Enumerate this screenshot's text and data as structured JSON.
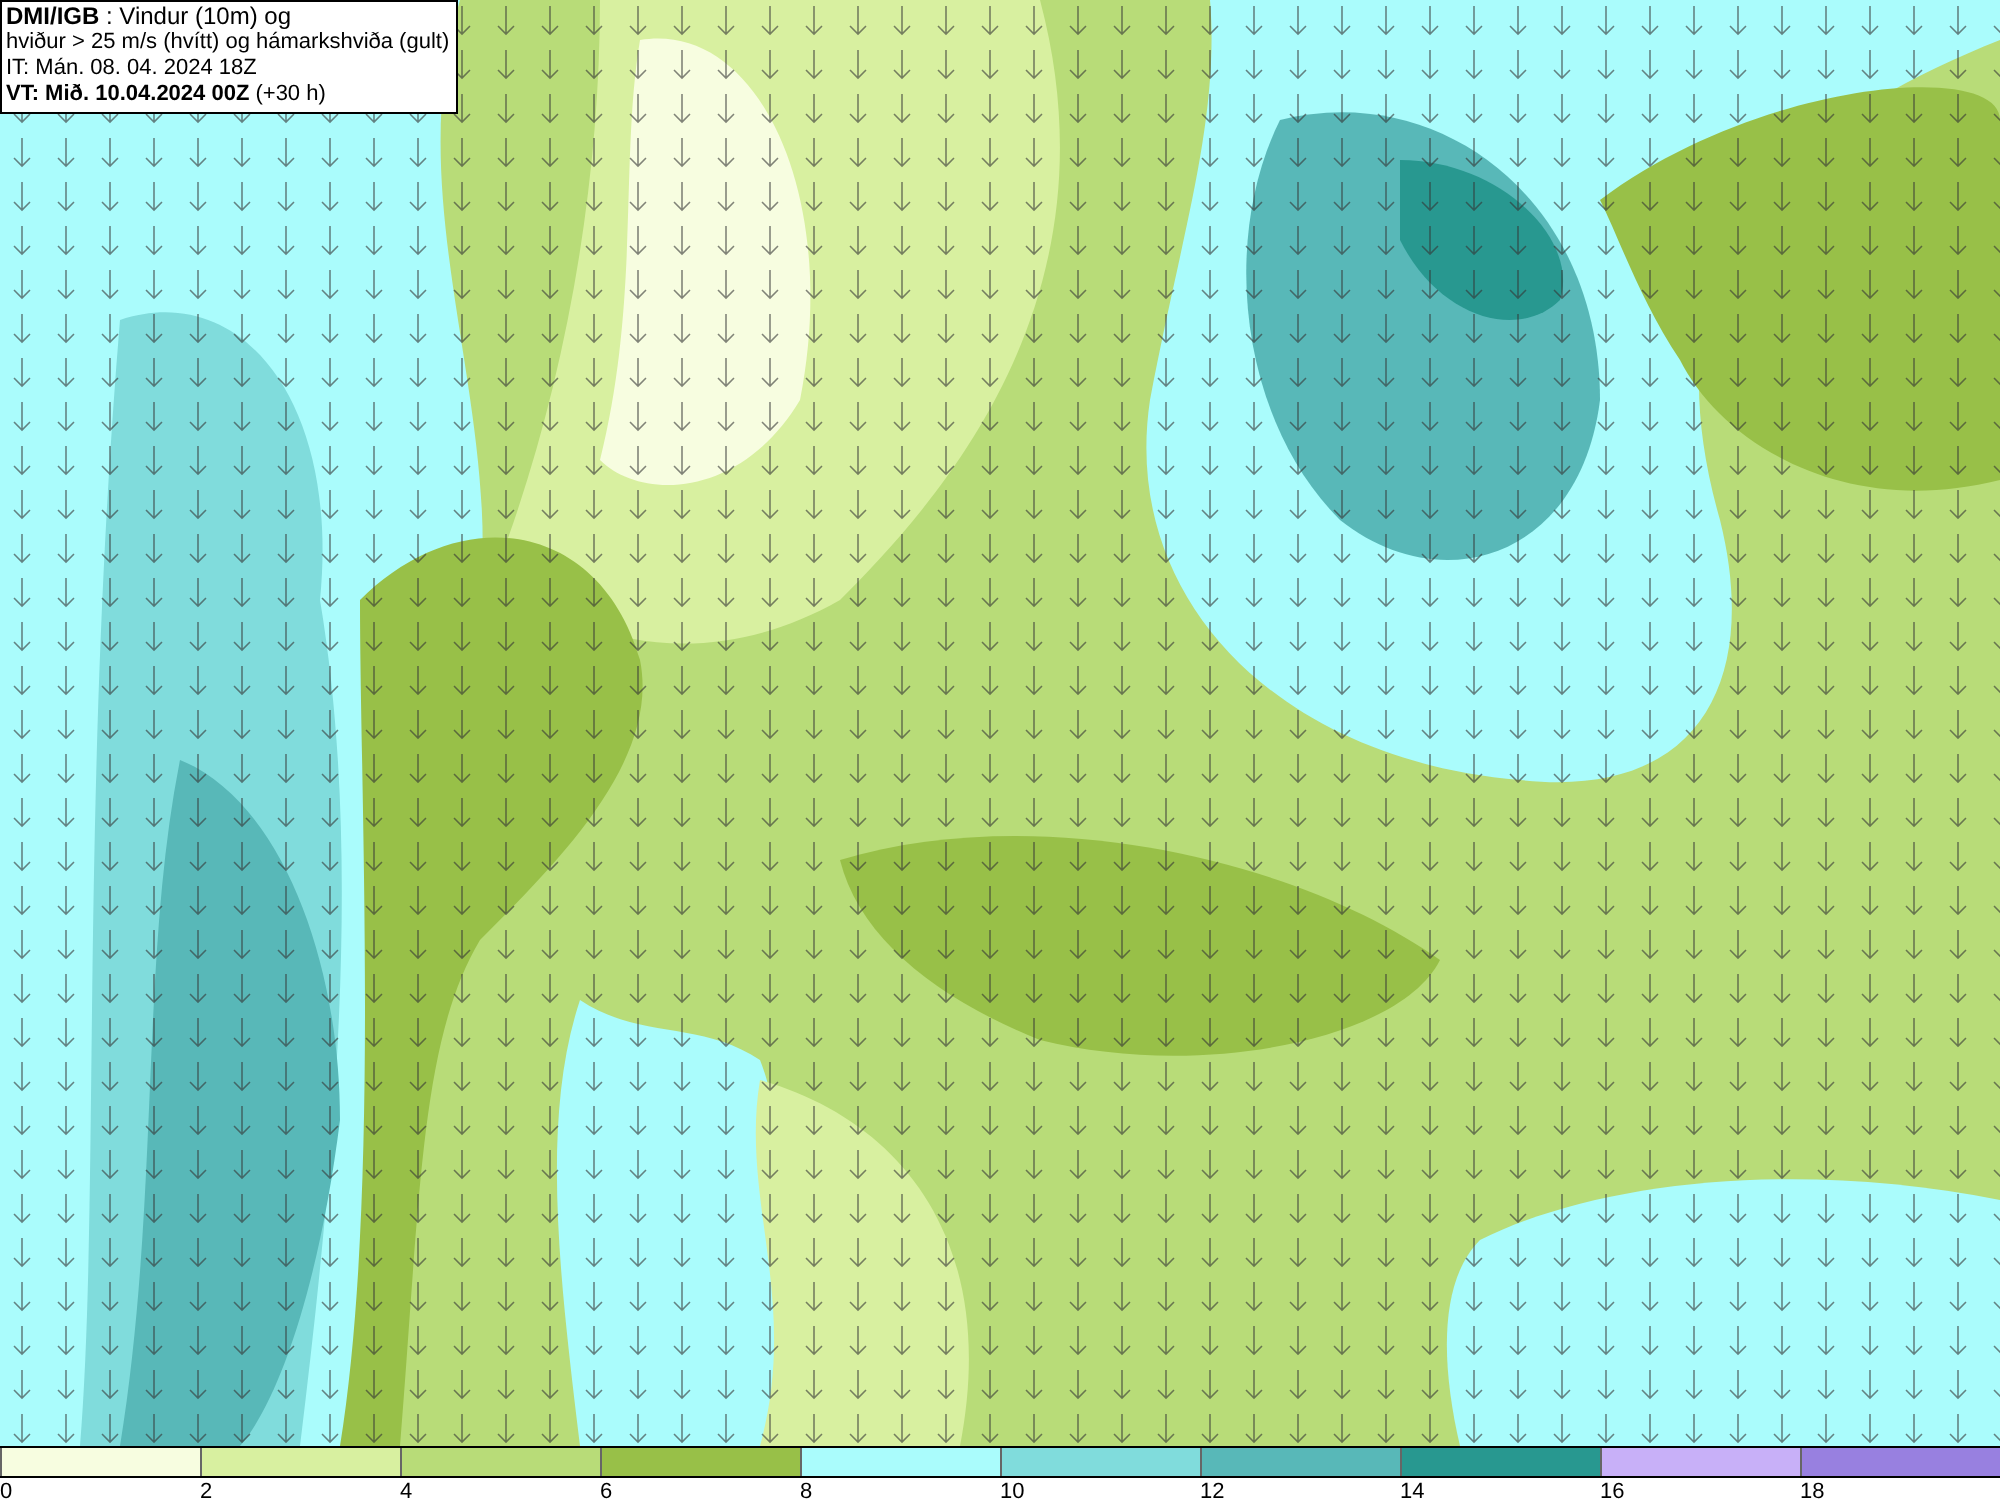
{
  "title_box": {
    "lines": [
      "**DMI/IGB** : Vindur (10m) og",
      "hviður > 25 m/s (hvítt) og hámarkshviða (gult)",
      "IT: Mán. 08. 04. 2024 18Z",
      "**VT: Mið. 10.04.2024 00Z** (+30 h)"
    ]
  },
  "legend": [
    {
      "label": "0",
      "color": "#f7fde0"
    },
    {
      "label": "2",
      "color": "#d8f0a0"
    },
    {
      "label": "4",
      "color": "#b8dc78"
    },
    {
      "label": "6",
      "color": "#98c048"
    },
    {
      "label": "8",
      "color": "#aafcfc"
    },
    {
      "label": "10",
      "color": "#80dcdc"
    },
    {
      "label": "12",
      "color": "#58b8b8"
    },
    {
      "label": "14",
      "color": "#289890"
    },
    {
      "label": "16",
      "color": "#c8b0f8"
    },
    {
      "label": "18",
      "color": "#9880e0"
    }
  ]
}
